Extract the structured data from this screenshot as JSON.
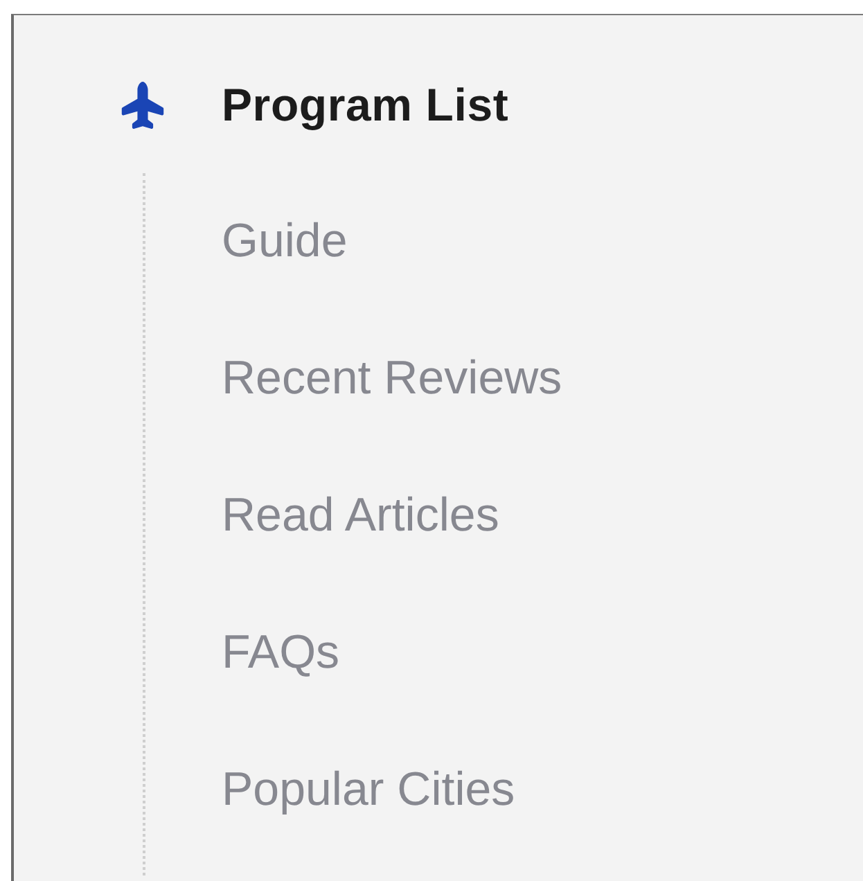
{
  "heading": {
    "label": "Program List"
  },
  "items": [
    {
      "label": "Guide"
    },
    {
      "label": "Recent Reviews"
    },
    {
      "label": "Read Articles"
    },
    {
      "label": "FAQs"
    },
    {
      "label": "Popular Cities"
    }
  ]
}
